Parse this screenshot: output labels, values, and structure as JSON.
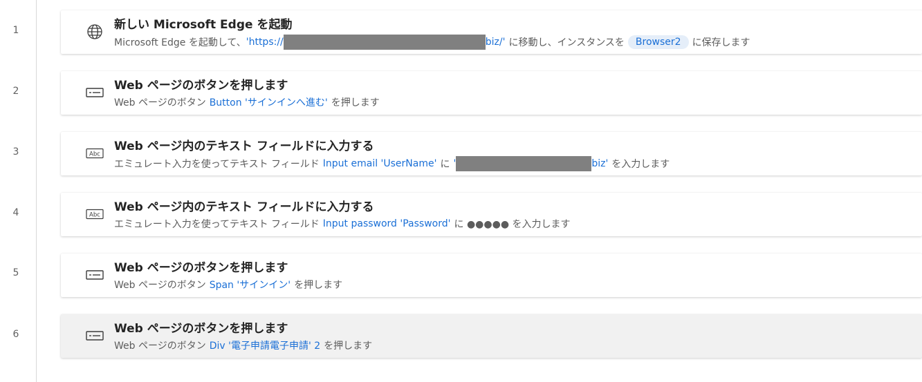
{
  "line_numbers": [
    "1",
    "2",
    "3",
    "4",
    "5",
    "6"
  ],
  "steps": [
    {
      "icon": "globe-icon",
      "title": "新しい Microsoft Edge を起動",
      "desc": {
        "t1": "Microsoft Edge を起動して、",
        "url_start": "'https://",
        "url_end": "biz/'",
        "t2": "に移動し、インスタンスを",
        "variable": "Browser2",
        "t3": "に保存します"
      }
    },
    {
      "icon": "button-icon",
      "title": "Web ページのボタンを押します",
      "desc": {
        "t1": "Web ページのボタン",
        "element": "Button 'サインインへ進む'",
        "t2": "を押します"
      }
    },
    {
      "icon": "textfield-icon",
      "icon_text": "Abc",
      "title": "Web ページ内のテキスト フィールドに入力する",
      "desc": {
        "t1": "エミュレート入力を使ってテキスト フィールド",
        "element": "Input email 'UserName'",
        "t2": "に",
        "value_start": "'",
        "value_end": "biz'",
        "t3": "を入力します"
      }
    },
    {
      "icon": "textfield-icon",
      "icon_text": "Abc",
      "title": "Web ページ内のテキスト フィールドに入力する",
      "desc": {
        "t1": "エミュレート入力を使ってテキスト フィールド",
        "element": "Input password 'Password'",
        "t2": "に ●●●●● を入力します"
      }
    },
    {
      "icon": "button-icon",
      "title": "Web ページのボタンを押します",
      "desc": {
        "t1": "Web ページのボタン",
        "element": "Span 'サインイン'",
        "t2": "を押します"
      }
    },
    {
      "icon": "button-icon",
      "title": "Web ページのボタンを押します",
      "selected": true,
      "desc": {
        "t1": "Web ページのボタン",
        "element": "Div '電子申請電子申請' 2",
        "t2": "を押します"
      }
    }
  ],
  "colors": {
    "link": "#1a6fd6",
    "title": "#242424",
    "desc": "#5c5c5c",
    "selected_bg": "#f1f1f1",
    "pill_bg": "#e5eef9",
    "redaction": "#808080"
  }
}
